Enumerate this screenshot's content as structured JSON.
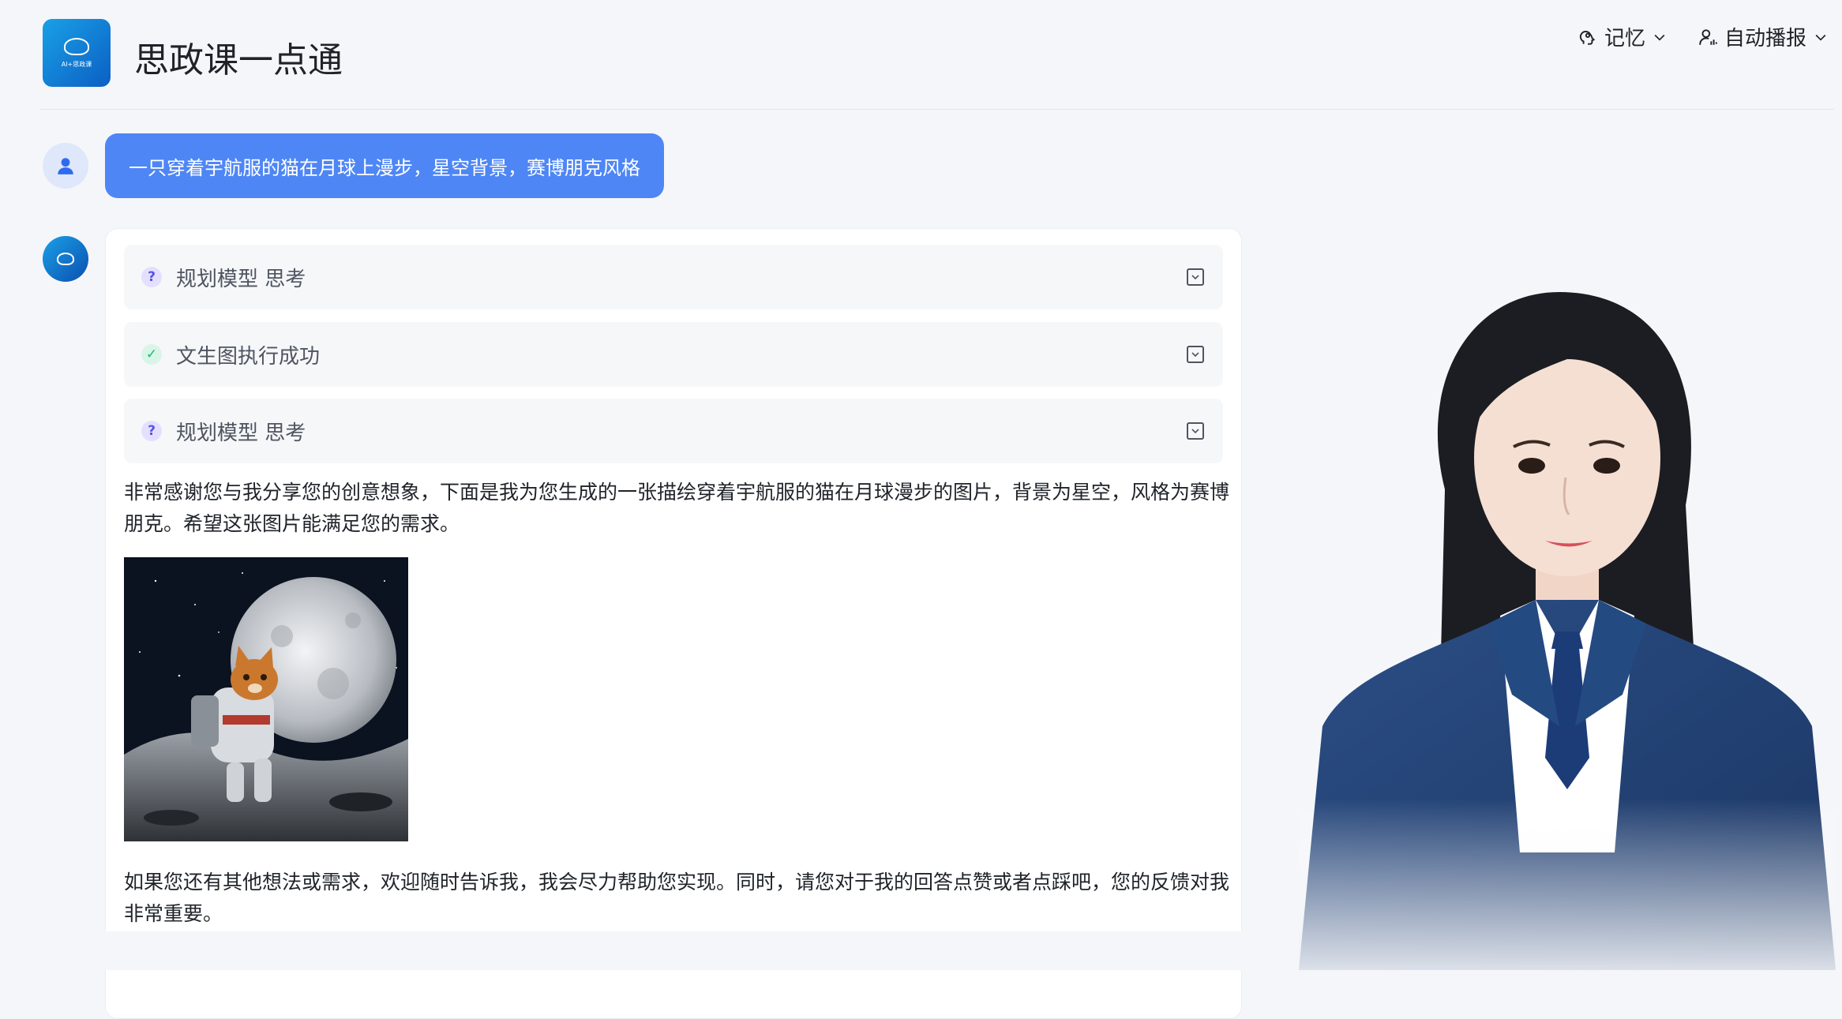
{
  "header": {
    "app_title": "思政课一点通",
    "logo_text": "AI+思政课",
    "memory_label": "记忆",
    "auto_broadcast_label": "自动播报"
  },
  "conversation": {
    "user_message": "一只穿着宇航服的猫在月球上漫步，星空背景，赛博朋克风格",
    "steps": [
      {
        "label": "规划模型 思考",
        "status": "question"
      },
      {
        "label": "文生图执行成功",
        "status": "success"
      },
      {
        "label": "规划模型 思考",
        "status": "question"
      }
    ],
    "reply_intro": "非常感谢您与我分享您的创意想象，下面是我为您生成的一张描绘穿着宇航服的猫在月球漫步的图片，背景为星空，风格为赛博朋克。希望这张图片能满足您的需求。",
    "reply_outro": "如果您还有其他想法或需求，欢迎随时告诉我，我会尽力帮助您实现。同时，请您对于我的回答点赞或者点踩吧，您的反馈对我非常重要。"
  },
  "colors": {
    "accent": "#4e86f5",
    "success": "#1fb877",
    "question": "#5b50e6",
    "background": "#f5f6fa"
  }
}
